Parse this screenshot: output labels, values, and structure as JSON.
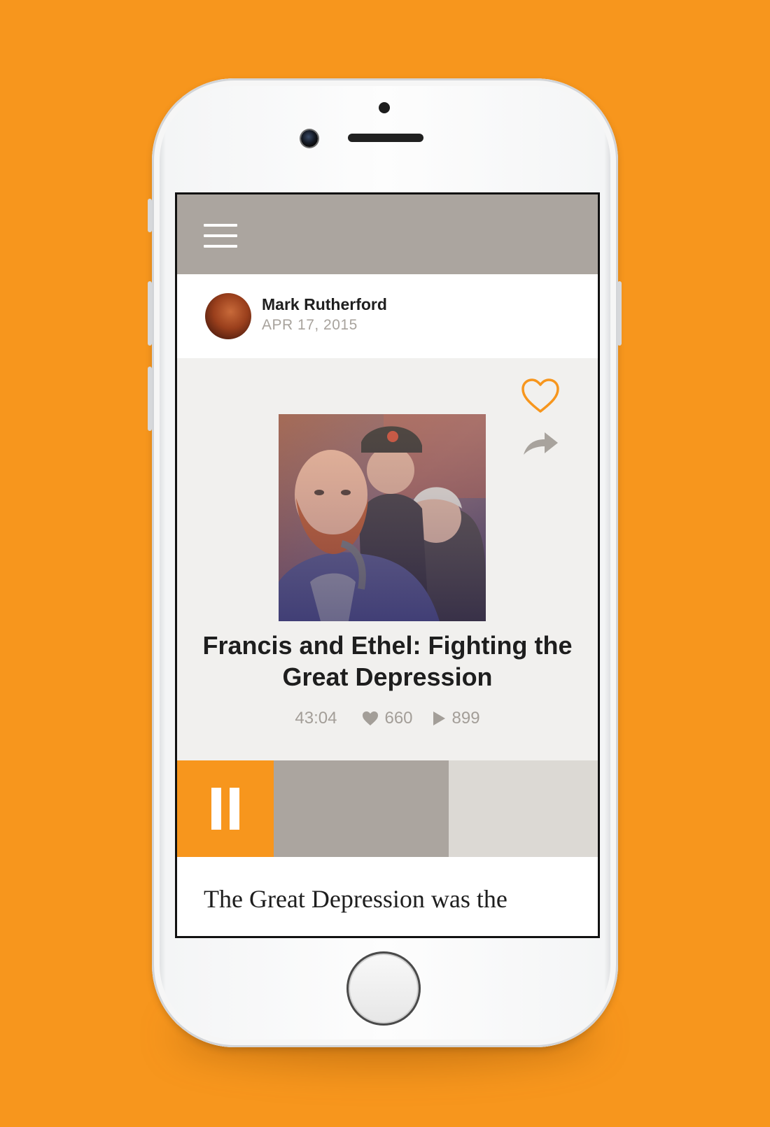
{
  "colors": {
    "background": "#F7961D",
    "accent": "#F7961D",
    "header_bar": "#ABA59F",
    "card": "#F1F0EE",
    "muted_text": "#A8A39D"
  },
  "header": {
    "menu_icon": "hamburger-menu-icon"
  },
  "post": {
    "author": "Mark Rutherford",
    "date": "APR 17, 2015",
    "avatar_icon": "avatar"
  },
  "story": {
    "title": "Francis and Ethel: Fighting the Great Depression",
    "duration": "43:04",
    "likes": "660",
    "plays": "899",
    "actions": {
      "like_icon": "heart-outline-icon",
      "share_icon": "share-arrow-icon"
    }
  },
  "player": {
    "state": "playing",
    "control_icon": "pause-icon",
    "progress": 0.54
  },
  "body": {
    "excerpt": "The Great Depression was the"
  }
}
